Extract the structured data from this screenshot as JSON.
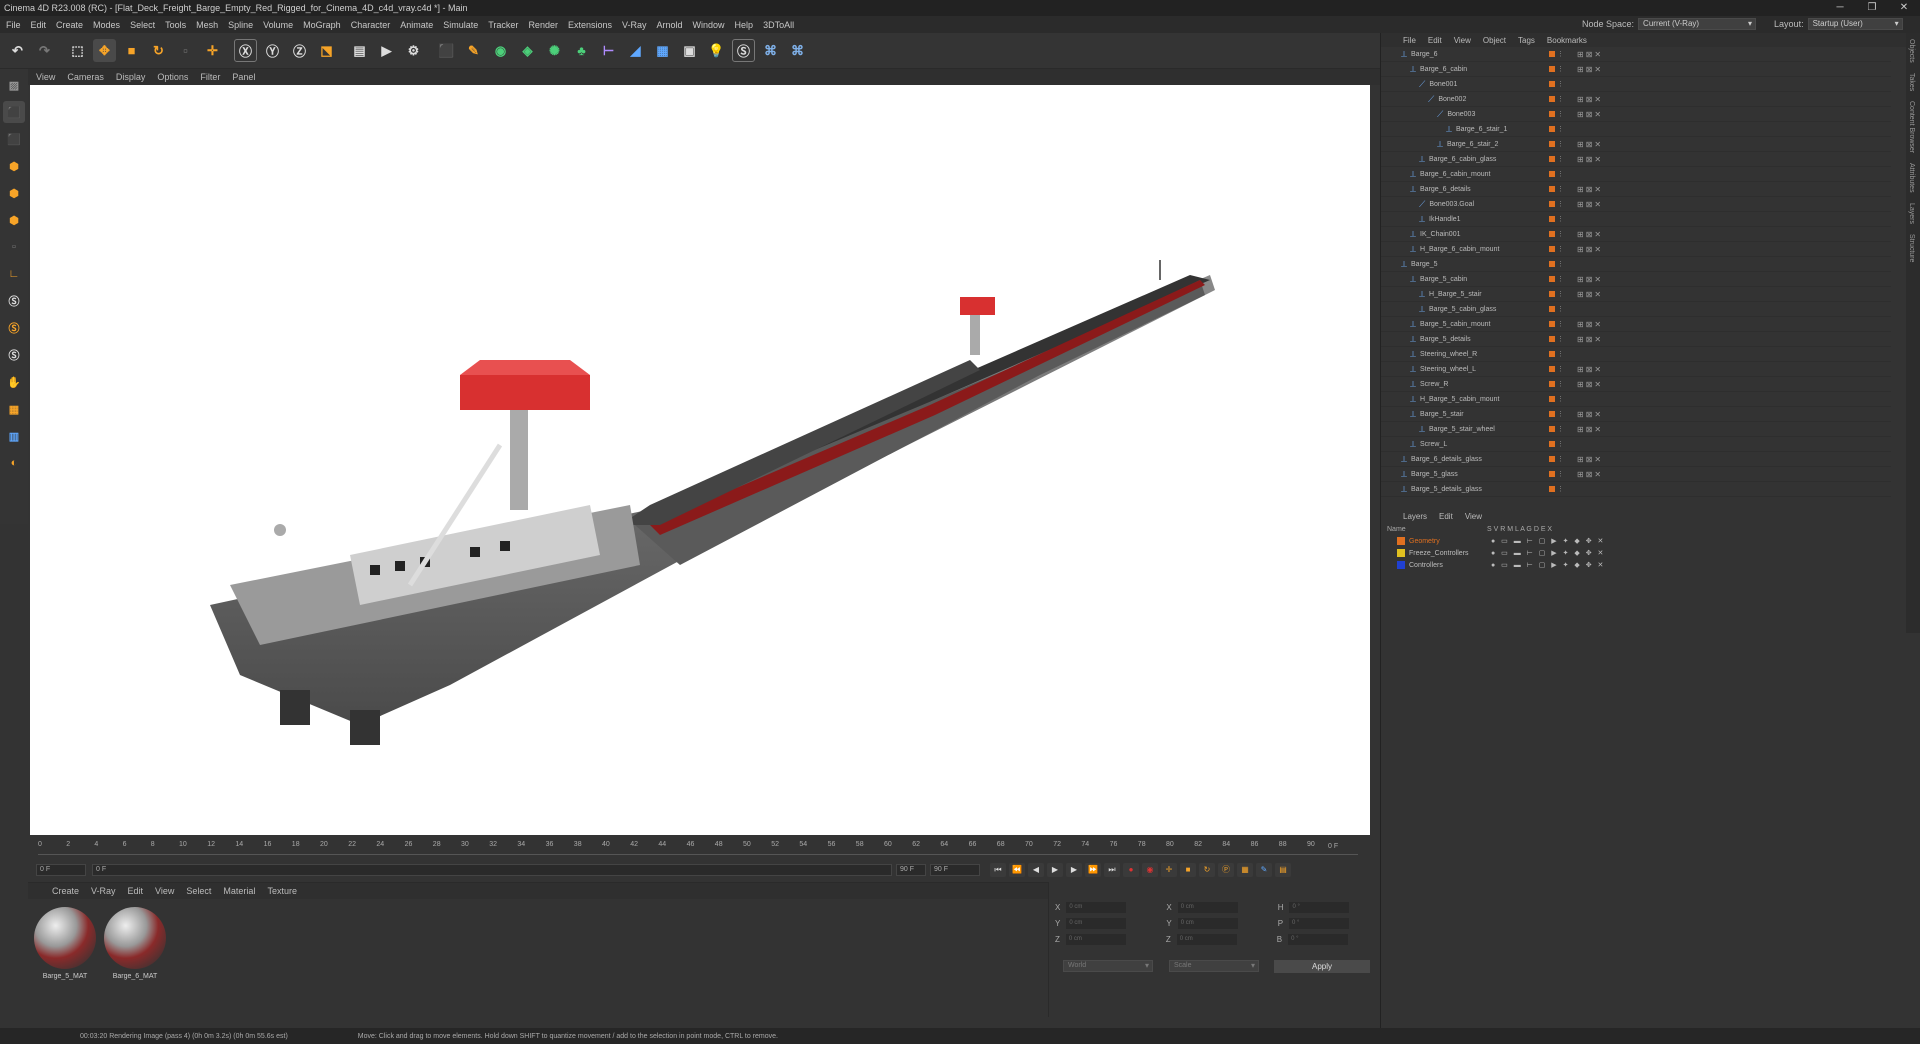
{
  "window": {
    "title": "Cinema 4D R23.008 (RC) - [Flat_Deck_Freight_Barge_Empty_Red_Rigged_for_Cinema_4D_c4d_vray.c4d *] - Main",
    "controls": [
      "─",
      "❐",
      "✕"
    ]
  },
  "menu": [
    "File",
    "Edit",
    "Create",
    "Modes",
    "Select",
    "Tools",
    "Mesh",
    "Spline",
    "Volume",
    "MoGraph",
    "Character",
    "Animate",
    "Simulate",
    "Tracker",
    "Render",
    "Extensions",
    "V-Ray",
    "Arnold",
    "Window",
    "Help",
    "3DToAll"
  ],
  "node_space": {
    "label": "Node Space:",
    "value": "Current (V-Ray)"
  },
  "layout": {
    "label": "Layout:",
    "value": "Startup (User)"
  },
  "viewport_menu": [
    "View",
    "Cameras",
    "Display",
    "Options",
    "Filter",
    "Panel"
  ],
  "timeline": {
    "ticks": [
      "0",
      "2",
      "4",
      "6",
      "8",
      "10",
      "12",
      "14",
      "16",
      "18",
      "20",
      "22",
      "24",
      "26",
      "28",
      "30",
      "32",
      "34",
      "36",
      "38",
      "40",
      "42",
      "44",
      "46",
      "48",
      "50",
      "52",
      "54",
      "56",
      "58",
      "60",
      "62",
      "64",
      "66",
      "68",
      "70",
      "72",
      "74",
      "76",
      "78",
      "80",
      "82",
      "84",
      "86",
      "88",
      "90"
    ],
    "end_frame": "0 F",
    "start_field": "0 F",
    "current_field": "0 F",
    "end_field1": "90 F",
    "end_field2": "90 F"
  },
  "material_menu": [
    "Create",
    "V-Ray",
    "Edit",
    "View",
    "Select",
    "Material",
    "Texture"
  ],
  "materials": [
    "Barge_5_MAT",
    "Barge_6_MAT"
  ],
  "coords": {
    "rows": [
      [
        "X",
        "0 cm",
        "X",
        "0 cm",
        "H",
        "0 °"
      ],
      [
        "Y",
        "0 cm",
        "Y",
        "0 cm",
        "P",
        "0 °"
      ],
      [
        "Z",
        "0 cm",
        "Z",
        "0 cm",
        "B",
        "0 °"
      ]
    ],
    "world": "World",
    "scale": "Scale",
    "apply": "Apply"
  },
  "object_menu": [
    "File",
    "Edit",
    "View",
    "Object",
    "Tags",
    "Bookmarks"
  ],
  "objects": [
    {
      "name": "Barge_6",
      "indent": 0
    },
    {
      "name": "Barge_6_cabin",
      "indent": 1
    },
    {
      "name": "Bone001",
      "indent": 2
    },
    {
      "name": "Bone002",
      "indent": 3
    },
    {
      "name": "Bone003",
      "indent": 4
    },
    {
      "name": "Barge_6_stair_1",
      "indent": 5
    },
    {
      "name": "Barge_6_stair_2",
      "indent": 4
    },
    {
      "name": "Barge_6_cabin_glass",
      "indent": 2
    },
    {
      "name": "Barge_6_cabin_mount",
      "indent": 1
    },
    {
      "name": "Barge_6_details",
      "indent": 1
    },
    {
      "name": "Bone003.Goal",
      "indent": 2
    },
    {
      "name": "IkHandle1",
      "indent": 2
    },
    {
      "name": "IK_Chain001",
      "indent": 1
    },
    {
      "name": "H_Barge_6_cabin_mount",
      "indent": 1
    },
    {
      "name": "Barge_5",
      "indent": 0
    },
    {
      "name": "Barge_5_cabin",
      "indent": 1
    },
    {
      "name": "H_Barge_5_stair",
      "indent": 2
    },
    {
      "name": "Barge_5_cabin_glass",
      "indent": 2
    },
    {
      "name": "Barge_5_cabin_mount",
      "indent": 1
    },
    {
      "name": "Barge_5_details",
      "indent": 1
    },
    {
      "name": "Steering_wheel_R",
      "indent": 1
    },
    {
      "name": "Steering_wheel_L",
      "indent": 1
    },
    {
      "name": "Screw_R",
      "indent": 1
    },
    {
      "name": "H_Barge_5_cabin_mount",
      "indent": 1
    },
    {
      "name": "Barge_5_stair",
      "indent": 1
    },
    {
      "name": "Barge_5_stair_wheel",
      "indent": 2
    },
    {
      "name": "Screw_L",
      "indent": 1
    },
    {
      "name": "Barge_6_details_glass",
      "indent": 0
    },
    {
      "name": "Barge_5_glass",
      "indent": 0
    },
    {
      "name": "Barge_5_details_glass",
      "indent": 0
    }
  ],
  "layers_menu": [
    "Layers",
    "Edit",
    "View"
  ],
  "layers_header": {
    "name": "Name",
    "flags": "S V R M L A G D E X"
  },
  "layers": [
    {
      "name": "Geometry",
      "color": "#e07020"
    },
    {
      "name": "Freeze_Controllers",
      "color": "#e0c020"
    },
    {
      "name": "Controllers",
      "color": "#2040d0"
    }
  ],
  "side_tabs": [
    "Objects",
    "Takes",
    "Content Browser",
    "Attributes",
    "Layers",
    "Structure"
  ],
  "status": {
    "render": "00:03:20 Rendering Image (pass 4) (0h 0m 3.2s) (0h 0m 55.6s est)",
    "hint": "Move: Click and drag to move elements. Hold down SHIFT to quantize movement / add to the selection in point mode, CTRL to remove."
  }
}
